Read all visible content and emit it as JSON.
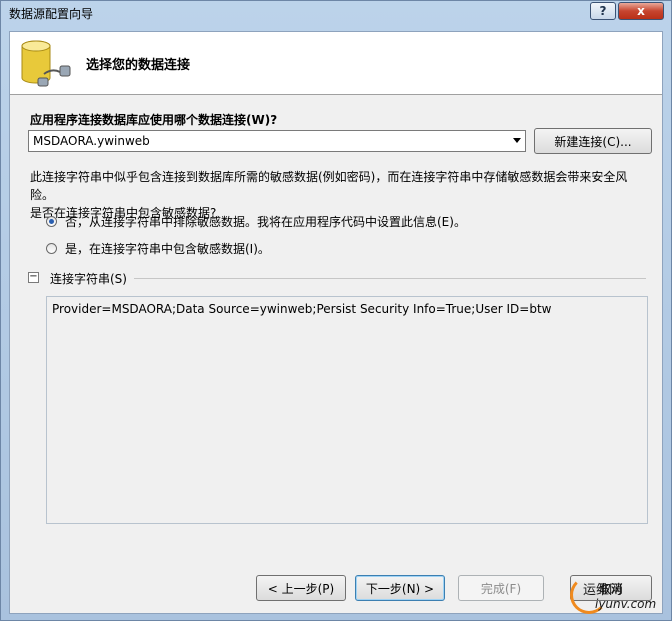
{
  "window": {
    "title": "数据源配置向导",
    "help_label": "?",
    "close_label": "x"
  },
  "header": {
    "title": "选择您的数据连接"
  },
  "connection": {
    "question": "应用程序连接数据库应使用哪个数据连接(W)?",
    "selected": "MSDAORA.ywinweb",
    "new_button": "新建连接(C)..."
  },
  "info": {
    "line1": "此连接字符串中似乎包含连接到数据库所需的敏感数据(例如密码)，而在连接字符串中存储敏感数据会带来安全风险。",
    "line2": "是否在连接字符串中包含敏感数据?"
  },
  "options": [
    {
      "label": "否，从连接字符串中排除敏感数据。我将在应用程序代码中设置此信息(E)。",
      "checked": true
    },
    {
      "label": "是，在连接字符串中包含敏感数据(I)。",
      "checked": false
    }
  ],
  "conn_section": {
    "expander": "−",
    "label": "连接字符串(S)",
    "value": "Provider=MSDAORA;Data Source=ywinweb;Persist Security Info=True;User ID=btw"
  },
  "footer": {
    "prev": "< 上一步(P)",
    "next": "下一步(N) >",
    "finish": "完成(F)",
    "cancel": "取消"
  },
  "watermark": {
    "line1": "运维网",
    "line2": "iyunv.com"
  },
  "colors": {
    "accent": "#3c7fb1",
    "close": "#c7452f",
    "db_icon": "#e8c93a"
  }
}
